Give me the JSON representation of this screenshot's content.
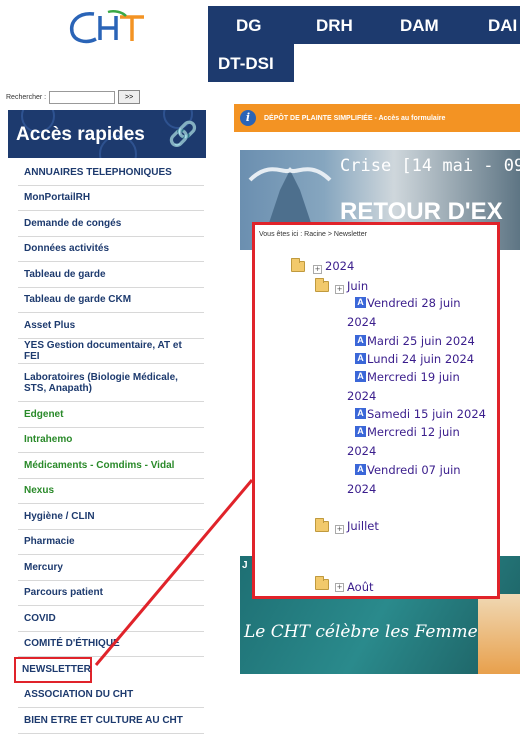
{
  "logo": {
    "name": "CHT-logo"
  },
  "topnav": {
    "items": [
      "DG",
      "DRH",
      "DAM",
      "DAI",
      "DT-DSI"
    ]
  },
  "search": {
    "label": "Rechercher :",
    "button": ">>"
  },
  "quick": {
    "title": "Accès rapides"
  },
  "menu": {
    "items": [
      {
        "label": "ANNUAIRES TELEPHONIQUES"
      },
      {
        "label": "MonPortailRH"
      },
      {
        "label": "Demande de congés"
      },
      {
        "label": "Données activités"
      },
      {
        "label": "Tableau de garde"
      },
      {
        "label": "Tableau de garde CKM"
      },
      {
        "label": "Asset Plus"
      },
      {
        "label": "YES Gestion documentaire, AT et FEI"
      },
      {
        "label": "Laboratoires (Biologie Médicale, STS, Anapath)"
      },
      {
        "label": "Edgenet"
      },
      {
        "label": "Intrahemo"
      },
      {
        "label": "Médicaments - Comdims - Vidal"
      },
      {
        "label": "Nexus"
      },
      {
        "label": "Hygiène / CLIN"
      },
      {
        "label": "Pharmacie"
      },
      {
        "label": "Mercury"
      },
      {
        "label": "Parcours patient"
      },
      {
        "label": "COVID"
      },
      {
        "label": "COMITÉ D'ÉTHIQUE"
      },
      {
        "label": "NEWSLETTER"
      },
      {
        "label": "ASSOCIATION DU CHT"
      },
      {
        "label": "BIEN ETRE ET CULTURE AU CHT"
      }
    ]
  },
  "banner": {
    "text": "DÉPÔT DE PLAINTE SIMPLIFIÉE - Accès au formulaire"
  },
  "hero": {
    "line1": "Crise [14 mai - 09",
    "line2": "RETOUR D'EX"
  },
  "bottom": {
    "caption": "Le CHT célèbre les Femmes",
    "side_letter": "J"
  },
  "popup": {
    "breadcrumb": "Vous êtes ici : Racine > Newsletter",
    "year": "2024",
    "month_juin": "Juin",
    "docs": [
      {
        "line1": "Vendredi 28 juin",
        "line2": "2024"
      },
      {
        "line1": "Mardi 25 juin 2024"
      },
      {
        "line1": "Lundi 24 juin 2024"
      },
      {
        "line1": "Mercredi 19 juin",
        "line2": "2024"
      },
      {
        "line1": "Samedi 15 juin 2024"
      },
      {
        "line1": "Mercredi 12 juin",
        "line2": "2024"
      },
      {
        "line1": "Vendredi 07 juin",
        "line2": "2024"
      }
    ],
    "month_juillet": "Juillet",
    "month_aout": "Août"
  }
}
